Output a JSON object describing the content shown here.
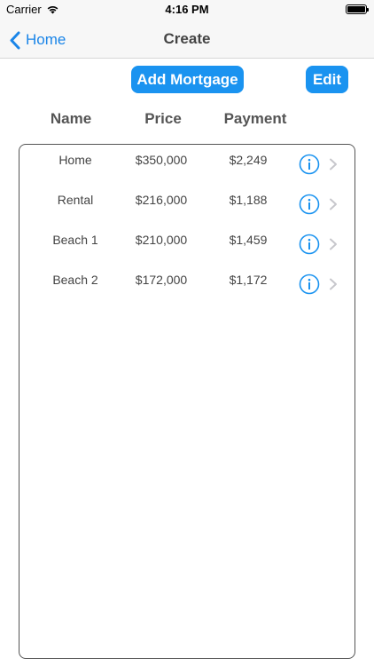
{
  "status_bar": {
    "carrier": "Carrier",
    "time": "4:16 PM",
    "wifi_icon": "wifi-icon",
    "battery_icon": "battery-icon"
  },
  "nav": {
    "back_label": "Home",
    "back_icon": "chevron-left-icon",
    "title": "Create"
  },
  "toolbar": {
    "add_label": "Add Mortgage",
    "edit_label": "Edit"
  },
  "columns": {
    "name": "Name",
    "price": "Price",
    "payment": "Payment"
  },
  "rows": [
    {
      "name": "Home",
      "price": "$350,000",
      "payment": "$2,249"
    },
    {
      "name": "Rental",
      "price": "$216,000",
      "payment": "$1,188"
    },
    {
      "name": "Beach 1",
      "price": "$210,000",
      "payment": "$1,459"
    },
    {
      "name": "Beach 2",
      "price": "$172,000",
      "payment": "$1,172"
    }
  ],
  "colors": {
    "accent": "#1a93f0",
    "link": "#1a85e8",
    "chevron": "#c7c7cc"
  }
}
